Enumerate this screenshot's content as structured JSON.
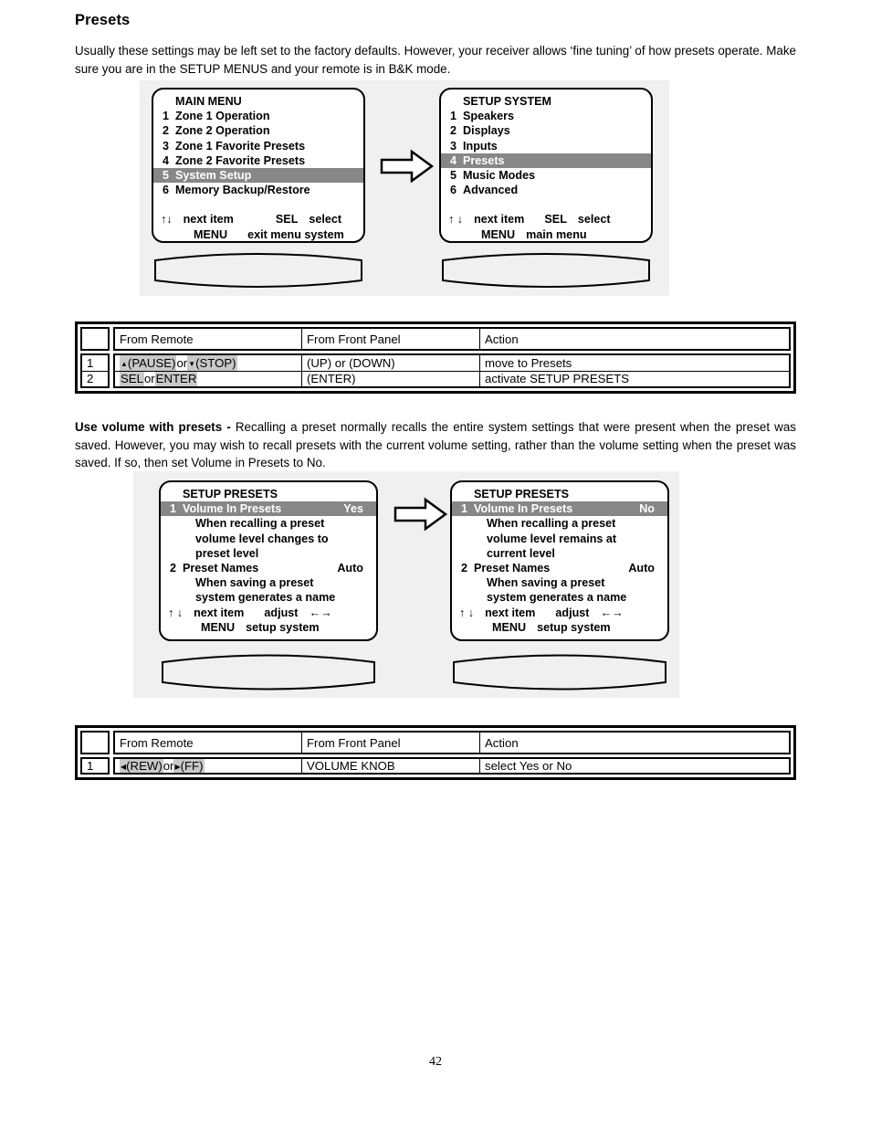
{
  "section": {
    "title": "Presets",
    "intro_paragraph": "Usually these settings may be left set to the factory defaults. However, your receiver allows ‘fine tuning’ of how presets operate. Make sure you are in the SETUP MENUS and your remote is in B&K mode.",
    "volume_paragraph_lead": "Use volume with presets - ",
    "volume_paragraph_body": "Recalling a preset normally recalls the entire system settings that were present when the preset was saved. However, you may wish to recall presets with the current volume setting, rather than the volume setting when the preset was saved. If so, then set Volume in Presets to No."
  },
  "colors": {
    "highlight_row": "#878787",
    "highlight_text": "#c9c9c9",
    "panel_background": "#f0f0f0",
    "border": "#000000"
  },
  "diagram1": {
    "arrow": "right-arrow",
    "screen_left": {
      "title": "MAIN MENU",
      "items": [
        {
          "num": "1",
          "label": "Zone 1 Operation",
          "selected": false
        },
        {
          "num": "2",
          "label": "Zone 2 Operation",
          "selected": false
        },
        {
          "num": "3",
          "label": "Zone 1 Favorite Presets",
          "selected": false
        },
        {
          "num": "4",
          "label": "Zone 2 Favorite Presets",
          "selected": false
        },
        {
          "num": "5",
          "label": "System Setup",
          "selected": true
        },
        {
          "num": "6",
          "label": "Memory Backup/Restore",
          "selected": false
        }
      ],
      "footer_line1_nav": "↑↓",
      "footer_line1_left": "next item",
      "footer_line1_key": "SEL",
      "footer_line1_right": "select",
      "footer_line2_key": "MENU",
      "footer_line2_text": "exit menu system"
    },
    "screen_right": {
      "title": "SETUP SYSTEM",
      "items": [
        {
          "num": "1",
          "label": "Speakers",
          "selected": false
        },
        {
          "num": "2",
          "label": "Displays",
          "selected": false
        },
        {
          "num": "3",
          "label": "Inputs",
          "selected": false
        },
        {
          "num": "4",
          "label": "Presets",
          "selected": true
        },
        {
          "num": "5",
          "label": "Music Modes",
          "selected": false
        },
        {
          "num": "6",
          "label": "Advanced",
          "selected": false
        }
      ],
      "footer_line1_nav": "↑ ↓",
      "footer_line1_left": "next item",
      "footer_line1_key": "SEL",
      "footer_line1_right": "select",
      "footer_line2_key": "MENU",
      "footer_line2_text": "main menu"
    }
  },
  "diagram2": {
    "arrow": "right-arrow",
    "screen_left": {
      "title": "SETUP PRESETS",
      "item1_num": "1",
      "item1_label": "Volume In Presets",
      "item1_value": "Yes",
      "item1_desc_line1": "When recalling a preset",
      "item1_desc_line2": "volume level changes to",
      "item1_desc_line3": "preset level",
      "item2_num": "2",
      "item2_label": "Preset Names",
      "item2_value": "Auto",
      "item2_desc_line1": "When saving a preset",
      "item2_desc_line2": "system generates a name",
      "footer_nav": "↑ ↓",
      "footer_left": "next item",
      "footer_adjust": "adjust",
      "footer_arrows": "←→",
      "footer_line2_key": "MENU",
      "footer_line2_text": "setup system"
    },
    "screen_right": {
      "title": "SETUP PRESETS",
      "item1_num": "1",
      "item1_label": "Volume In Presets",
      "item1_value": "No",
      "item1_desc_line1": "When recalling a preset",
      "item1_desc_line2": "volume level remains at",
      "item1_desc_line3": "current level",
      "item2_num": "2",
      "item2_label": "Preset Names",
      "item2_value": "Auto",
      "item2_desc_line1": "When saving a preset",
      "item2_desc_line2": "system generates a name",
      "footer_nav": "↑ ↓",
      "footer_left": "next item",
      "footer_adjust": "adjust",
      "footer_arrows": "←→",
      "footer_line2_key": "MENU",
      "footer_line2_text": "setup system"
    }
  },
  "table1": {
    "headers": {
      "index": "",
      "from_remote": "From Remote",
      "from_front_panel": "From Front Panel",
      "action": "Action"
    },
    "rows": [
      {
        "index": "1",
        "remote_key_a": "(PAUSE)",
        "remote_join": " or ",
        "remote_key_b": "(STOP)",
        "remote_icon_a": "triangle-up-icon",
        "remote_icon_b": "triangle-down-icon",
        "front_panel": "(UP) or (DOWN)",
        "action": "move to Presets"
      },
      {
        "index": "2",
        "remote_key_a": "SEL",
        "remote_join": " or ",
        "remote_key_b": "ENTER",
        "remote_icon_a": "",
        "remote_icon_b": "",
        "front_panel": "(ENTER)",
        "action": "activate SETUP PRESETS"
      }
    ]
  },
  "table2": {
    "headers": {
      "index": "",
      "from_remote": "From Remote",
      "from_front_panel": "From Front Panel",
      "action": "Action"
    },
    "rows": [
      {
        "index": "1",
        "remote_key_a": "(REW)",
        "remote_join": " or ",
        "remote_key_b": "(FF)",
        "remote_icon_a": "triangle-left-icon",
        "remote_icon_b": "triangle-right-icon",
        "front_panel": "VOLUME KNOB",
        "action": "select Yes or No"
      }
    ]
  },
  "footer": {
    "page_number": "42"
  }
}
